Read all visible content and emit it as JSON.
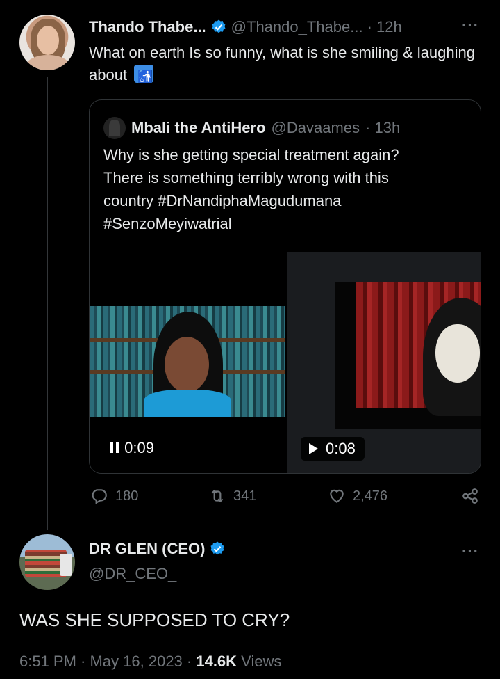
{
  "tweet": {
    "author_name": "Thando Thabe...",
    "author_handle": "@Thando_Thabe...",
    "time": "· 12h",
    "more": "···",
    "text": "What on earth Is so funny, what is she smiling & laughing about",
    "emoji": "🚮"
  },
  "quote": {
    "author_name": "Mbali the AntiHero",
    "author_handle": "@Davaames",
    "time": "· 13h",
    "text_line1": "Why is she getting special treatment again?",
    "text_line2": "There is something terribly wrong with this",
    "text_line3": "country #DrNandiphaMagudumana",
    "text_line4": "#SenzoMeyiwatrial",
    "video1": {
      "state_icon": "pause-icon",
      "duration": "0:09"
    },
    "video2": {
      "state_icon": "play-icon",
      "duration": "0:08"
    }
  },
  "actions": {
    "replies": "180",
    "retweets": "341",
    "likes": "2,476"
  },
  "reply": {
    "author_name": "DR GLEN (CEO)",
    "author_handle": "@DR_CEO_",
    "more": "···",
    "text": "WAS SHE SUPPOSED TO CRY?",
    "time": "6:51 PM · May 16, 2023 · ",
    "views_count": "14.6K",
    "views_label": " Views"
  },
  "colors": {
    "background": "#000000",
    "text": "#e7e9ea",
    "muted": "#71767b",
    "verified": "#1d9bf0",
    "border": "#2f3336"
  }
}
